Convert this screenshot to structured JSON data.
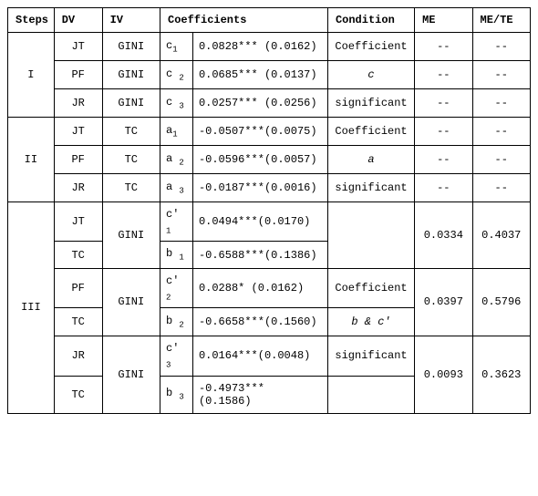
{
  "headers": {
    "steps": "Steps",
    "dv": "DV",
    "iv": "IV",
    "coef": "Coefficients",
    "cond": "Condition",
    "me": "ME",
    "mete": "ME/TE"
  },
  "steps": {
    "I": "I",
    "II": "II",
    "III": "III"
  },
  "dv": {
    "jt": "JT",
    "pf": "PF",
    "jr": "JR",
    "tc": "TC"
  },
  "iv": {
    "gini": "GINI",
    "tc": "TC"
  },
  "coef": {
    "I": {
      "sym1": "c",
      "sub1": "1",
      "val1": "0.0828*** (0.0162)",
      "sym2": "c ",
      "sub2": "2",
      "val2": "0.0685*** (0.0137)",
      "sym3": "c ",
      "sub3": "3",
      "val3": "0.0257*** (0.0256)"
    },
    "II": {
      "sym1": "a",
      "sub1": "1",
      "val1": "-0.0507***(0.0075)",
      "sym2": "a ",
      "sub2": "2",
      "val2": "-0.0596***(0.0057)",
      "sym3": "a ",
      "sub3": "3",
      "val3": "-0.0187***(0.0016)"
    },
    "III": {
      "sym1": "c' ",
      "sub1": "1",
      "val1": "0.0494***(0.0170)",
      "sym2": "b ",
      "sub2": "1",
      "val2": "-0.6588***(0.1386)",
      "sym3": "c' ",
      "sub3": "2",
      "val3": "0.0288*  (0.0162)",
      "sym4": "b ",
      "sub4": "2",
      "val4": "-0.6658***(0.1560)",
      "sym5": "c' ",
      "sub5": "3",
      "val5": "0.0164***(0.0048)",
      "sym6": "b ",
      "sub6": "3",
      "val6": "-0.4973***\n(0.1586)"
    }
  },
  "cond": {
    "I": {
      "l1": "Coefficient",
      "l2": "c",
      "l3": "significant"
    },
    "II": {
      "l1": "Coefficient",
      "l2": "a",
      "l3": "significant"
    },
    "III": {
      "l1": "Coefficient",
      "l2": "b & c'",
      "l3": "significant"
    }
  },
  "me": {
    "I1": "--",
    "I2": "--",
    "I3": "--",
    "II1": "--",
    "II2": "--",
    "II3": "--",
    "III1": "0.0334",
    "III2": "0.0397",
    "III3": "0.0093"
  },
  "mete": {
    "I1": "--",
    "I2": "--",
    "I3": "--",
    "II1": "--",
    "II2": "--",
    "II3": "--",
    "III1": "0.4037",
    "III2": "0.5796",
    "III3": "0.3623"
  },
  "chart_data": {
    "type": "table",
    "title": "Mediation analysis steps",
    "columns": [
      "Steps",
      "DV",
      "IV",
      "Coefficient Symbol",
      "Coefficient Value",
      "Condition",
      "ME",
      "ME/TE"
    ],
    "rows": [
      [
        "I",
        "JT",
        "GINI",
        "c1",
        "0.0828*** (0.0162)",
        "Coefficient c significant",
        "--",
        "--"
      ],
      [
        "I",
        "PF",
        "GINI",
        "c2",
        "0.0685*** (0.0137)",
        "Coefficient c significant",
        "--",
        "--"
      ],
      [
        "I",
        "JR",
        "GINI",
        "c3",
        "0.0257*** (0.0256)",
        "Coefficient c significant",
        "--",
        "--"
      ],
      [
        "II",
        "JT",
        "TC",
        "a1",
        "-0.0507*** (0.0075)",
        "Coefficient a significant",
        "--",
        "--"
      ],
      [
        "II",
        "PF",
        "TC",
        "a2",
        "-0.0596*** (0.0057)",
        "Coefficient a significant",
        "--",
        "--"
      ],
      [
        "II",
        "JR",
        "TC",
        "a3",
        "-0.0187*** (0.0016)",
        "Coefficient a significant",
        "--",
        "--"
      ],
      [
        "III",
        "JT",
        "GINI",
        "c'1",
        "0.0494*** (0.0170)",
        "Coefficient b & c' significant",
        "0.0334",
        "0.4037"
      ],
      [
        "III",
        "TC",
        "GINI",
        "b1",
        "-0.6588*** (0.1386)",
        "Coefficient b & c' significant",
        "0.0334",
        "0.4037"
      ],
      [
        "III",
        "PF",
        "GINI",
        "c'2",
        "0.0288* (0.0162)",
        "Coefficient b & c' significant",
        "0.0397",
        "0.5796"
      ],
      [
        "III",
        "TC",
        "GINI",
        "b2",
        "-0.6658*** (0.1560)",
        "Coefficient b & c' significant",
        "0.0397",
        "0.5796"
      ],
      [
        "III",
        "JR",
        "GINI",
        "c'3",
        "0.0164*** (0.0048)",
        "Coefficient b & c' significant",
        "0.0093",
        "0.3623"
      ],
      [
        "III",
        "TC",
        "GINI",
        "b3",
        "-0.4973*** (0.1586)",
        "Coefficient b & c' significant",
        "0.0093",
        "0.3623"
      ]
    ]
  }
}
